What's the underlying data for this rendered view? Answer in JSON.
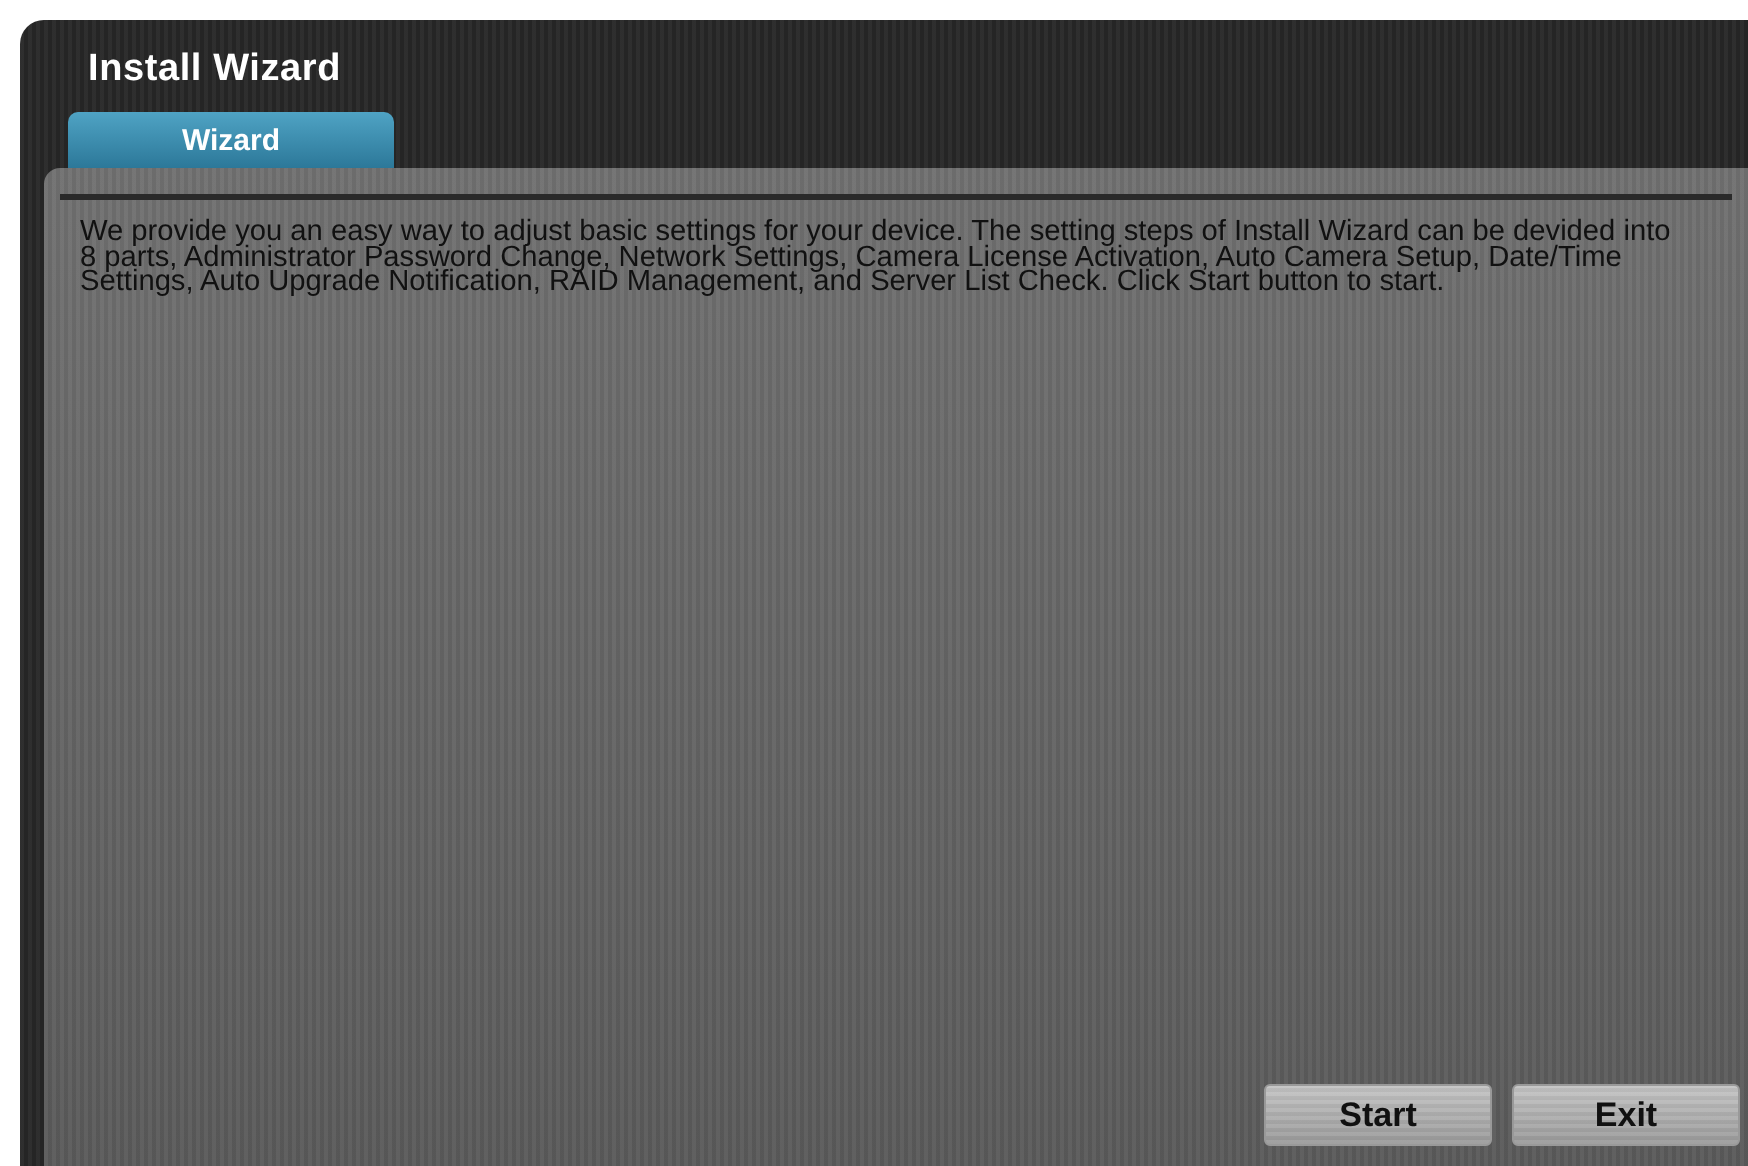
{
  "window": {
    "title": "Install Wizard"
  },
  "tabs": [
    {
      "label": "Wizard",
      "selected": true
    }
  ],
  "description": "We provide you an easy way to adjust basic settings for your device. The setting steps of Install Wizard can be devided into 8 parts, Administrator Password Change,  Network Settings, Camera License Activation, Auto Camera Setup, Date/Time Settings, Auto Upgrade Notification, RAID Management, and Server List Check. Click Start button to start.",
  "buttons": [
    "Start",
    "Exit"
  ]
}
